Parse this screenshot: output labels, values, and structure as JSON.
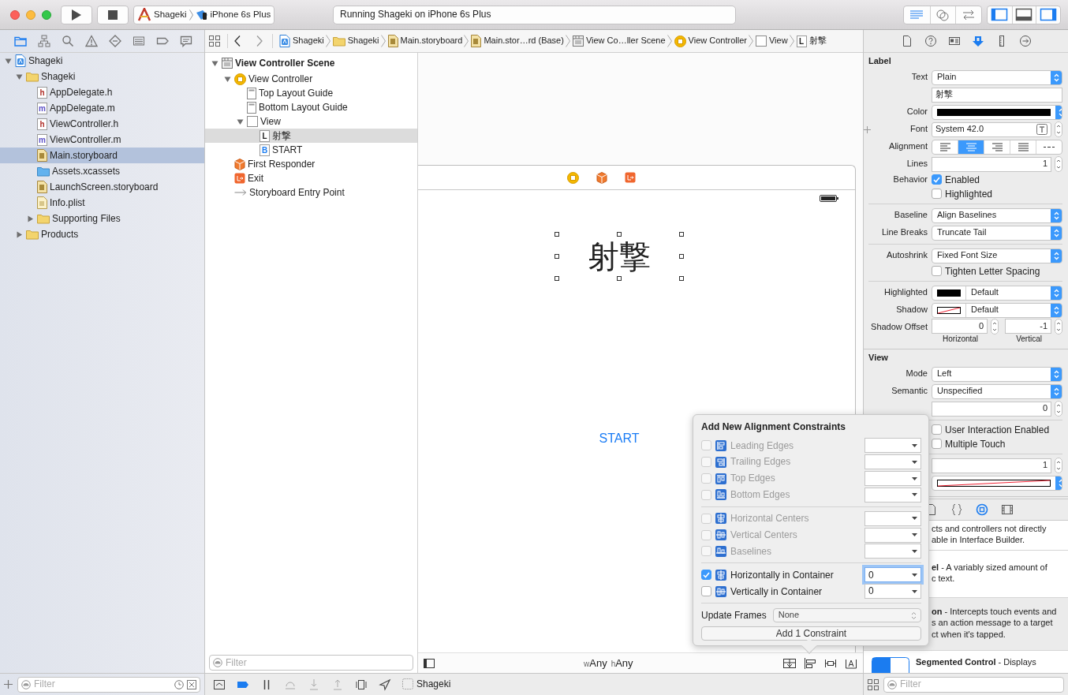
{
  "toolbar": {
    "scheme": "Shageki",
    "device": "iPhone 6s Plus",
    "status": "Running Shageki on iPhone 6s Plus",
    "editor_modes": [
      {
        "kind": "standard",
        "selected": true
      },
      {
        "kind": "assistant",
        "selected": false
      },
      {
        "kind": "version",
        "selected": false
      }
    ],
    "panels": [
      {
        "kind": "navigator",
        "on": true
      },
      {
        "kind": "debug",
        "on": false
      },
      {
        "kind": "utilities",
        "on": true
      }
    ]
  },
  "navigator": {
    "tabs": [
      {
        "kind": "project",
        "selected": true
      },
      {
        "kind": "symbol",
        "selected": false
      },
      {
        "kind": "find",
        "selected": false
      },
      {
        "kind": "issue",
        "selected": false
      },
      {
        "kind": "test",
        "selected": false
      },
      {
        "kind": "debug",
        "selected": false
      },
      {
        "kind": "breakpoint",
        "selected": false
      },
      {
        "kind": "report",
        "selected": false
      }
    ],
    "tree": [
      {
        "label": "Shageki",
        "kind": "project",
        "expanded": true,
        "selected": false,
        "children": [
          {
            "label": "Shageki",
            "kind": "folder",
            "expanded": true,
            "selected": false,
            "children": [
              {
                "label": "AppDelegate.h",
                "kind": "header",
                "glyph": "h",
                "selected": false
              },
              {
                "label": "AppDelegate.m",
                "kind": "source",
                "glyph": "m",
                "selected": false
              },
              {
                "label": "ViewController.h",
                "kind": "header",
                "glyph": "h",
                "selected": false
              },
              {
                "label": "ViewController.m",
                "kind": "source",
                "glyph": "m",
                "selected": false
              },
              {
                "label": "Main.storyboard",
                "kind": "storyboard",
                "selected": true
              },
              {
                "label": "Assets.xcassets",
                "kind": "assets",
                "selected": false
              },
              {
                "label": "LaunchScreen.storyboard",
                "kind": "storyboard",
                "selected": false
              },
              {
                "label": "Info.plist",
                "kind": "plist",
                "selected": false
              },
              {
                "label": "Supporting Files",
                "kind": "folder",
                "expanded": false,
                "selected": false
              }
            ]
          },
          {
            "label": "Products",
            "kind": "folder",
            "expanded": false,
            "selected": false
          }
        ]
      }
    ],
    "filter": {
      "placeholder": "Filter"
    }
  },
  "jump_bar": {
    "crumbs": [
      {
        "kind": "project",
        "label": "Shageki"
      },
      {
        "kind": "folder",
        "label": "Shageki"
      },
      {
        "kind": "storyboard",
        "label": "Main.storyboard"
      },
      {
        "kind": "storyboard",
        "label": "Main.stor…rd (Base)"
      },
      {
        "kind": "scene",
        "label": "View Co…ller Scene"
      },
      {
        "kind": "controller",
        "label": "View Controller"
      },
      {
        "kind": "view",
        "label": "View"
      },
      {
        "kind": "label",
        "glyph": "L",
        "label": "射撃"
      }
    ]
  },
  "outline": {
    "tree": [
      {
        "label": "View Controller Scene",
        "kind": "scene",
        "expanded": true,
        "selected": false,
        "children": [
          {
            "label": "View Controller",
            "kind": "controller",
            "expanded": true,
            "selected": false,
            "children": [
              {
                "label": "Top Layout Guide",
                "kind": "guide",
                "selected": false
              },
              {
                "label": "Bottom Layout Guide",
                "kind": "guide",
                "selected": false
              },
              {
                "label": "View",
                "kind": "view",
                "expanded": true,
                "selected": false,
                "children": [
                  {
                    "label": "射撃",
                    "kind": "label",
                    "glyph": "L",
                    "selected": true
                  },
                  {
                    "label": "START",
                    "kind": "button",
                    "glyph": "B",
                    "selected": false
                  }
                ]
              }
            ]
          },
          {
            "label": "First Responder",
            "kind": "responder",
            "selected": false
          },
          {
            "label": "Exit",
            "kind": "exit",
            "selected": false
          },
          {
            "label": "Storyboard Entry Point",
            "kind": "entry",
            "selected": false
          }
        ]
      }
    ],
    "filter": {
      "placeholder": "Filter"
    }
  },
  "canvas": {
    "dock": [
      {
        "kind": "controller"
      },
      {
        "kind": "responder"
      },
      {
        "kind": "exit"
      }
    ],
    "label": "射撃",
    "button": "START",
    "size_class": {
      "width_prefix": "w",
      "width_value": "Any",
      "height_prefix": "h",
      "height_value": "Any"
    },
    "tools": [
      {
        "kind": "embed"
      },
      {
        "kind": "align"
      },
      {
        "kind": "pin"
      },
      {
        "kind": "resolve"
      }
    ]
  },
  "popover": {
    "title": "Add New Alignment Constraints",
    "groups": [
      {
        "rows": [
          {
            "kind": "leading",
            "label": "Leading Edges",
            "checked": false,
            "disabled": true,
            "focused": false
          },
          {
            "kind": "trailing",
            "label": "Trailing Edges",
            "checked": false,
            "disabled": true,
            "focused": false
          },
          {
            "kind": "top",
            "label": "Top Edges",
            "checked": false,
            "disabled": true,
            "focused": false
          },
          {
            "kind": "bottom",
            "label": "Bottom Edges",
            "checked": false,
            "disabled": true,
            "focused": false
          }
        ]
      },
      {
        "rows": [
          {
            "kind": "hcenter",
            "label": "Horizontal Centers",
            "checked": false,
            "disabled": true,
            "focused": false
          },
          {
            "kind": "vcenter",
            "label": "Vertical Centers",
            "checked": false,
            "disabled": true,
            "focused": false
          },
          {
            "kind": "baseline",
            "label": "Baselines",
            "checked": false,
            "disabled": true,
            "focused": false
          }
        ]
      },
      {
        "rows": [
          {
            "kind": "hcenter",
            "label": "Horizontally in Container",
            "checked": true,
            "disabled": false,
            "focused": true,
            "value": "0"
          },
          {
            "kind": "vcenter",
            "label": "Vertically in Container",
            "checked": false,
            "disabled": false,
            "focused": false,
            "value": "0"
          }
        ]
      }
    ],
    "update_frames": {
      "label": "Update Frames",
      "value": "None"
    },
    "button": "Add 1 Constraint"
  },
  "inspector": {
    "tabs": [
      {
        "kind": "file",
        "selected": false
      },
      {
        "kind": "help",
        "selected": false
      },
      {
        "kind": "identity",
        "selected": false
      },
      {
        "kind": "attributes",
        "selected": true
      },
      {
        "kind": "size",
        "selected": false
      },
      {
        "kind": "connections",
        "selected": false
      }
    ],
    "sections": [
      {
        "title": "Label",
        "rows": [
          {
            "kind": "popup",
            "label": "Text",
            "value": "Plain"
          },
          {
            "kind": "text",
            "value": "射撃"
          },
          {
            "kind": "color",
            "label": "Color",
            "clear": false
          },
          {
            "kind": "font",
            "label": "Font",
            "value": "System 42.0"
          },
          {
            "kind": "segmented",
            "label": "Alignment",
            "segments": [
              {
                "kind": "left",
                "selected": false
              },
              {
                "kind": "center",
                "selected": true
              },
              {
                "kind": "right",
                "selected": false
              },
              {
                "kind": "justified",
                "selected": false
              },
              {
                "kind": "natural",
                "selected": false
              }
            ]
          },
          {
            "kind": "stepper",
            "label": "Lines",
            "value": "1"
          },
          {
            "kind": "checkbox",
            "label": "Behavior",
            "text": "Enabled",
            "checked": true
          },
          {
            "kind": "checkbox",
            "text": "Highlighted",
            "checked": false
          },
          {
            "kind": "divider"
          },
          {
            "kind": "popup",
            "label": "Baseline",
            "value": "Align Baselines"
          },
          {
            "kind": "popup",
            "label": "Line Breaks",
            "value": "Truncate Tail"
          },
          {
            "kind": "divider"
          },
          {
            "kind": "popup",
            "label": "Autoshrink",
            "value": "Fixed Font Size"
          },
          {
            "kind": "checkbox",
            "text": "Tighten Letter Spacing",
            "checked": false
          },
          {
            "kind": "divider"
          },
          {
            "kind": "color-popup",
            "label": "Highlighted",
            "clear": false,
            "value": "Default"
          },
          {
            "kind": "color-popup",
            "label": "Shadow",
            "clear": true,
            "value": "Default"
          },
          {
            "kind": "offset",
            "label": "Shadow Offset",
            "fields": [
              {
                "value": "0",
                "caption": "Horizontal"
              },
              {
                "value": "-1",
                "caption": "Vertical"
              }
            ]
          }
        ]
      },
      {
        "title": "View",
        "rows": [
          {
            "kind": "popup",
            "label": "Mode",
            "value": "Left"
          },
          {
            "kind": "popup",
            "label": "Semantic",
            "value": "Unspecified"
          },
          {
            "kind": "stepper",
            "value": "0"
          },
          {
            "kind": "divider"
          },
          {
            "kind": "checkbox",
            "text": "User Interaction Enabled",
            "checked": false
          },
          {
            "kind": "checkbox",
            "text": "Multiple Touch",
            "checked": false
          },
          {
            "kind": "divider"
          },
          {
            "kind": "stepper",
            "value": "1"
          },
          {
            "kind": "color",
            "clear": true
          }
        ]
      }
    ]
  },
  "library": {
    "tabs": [
      {
        "kind": "file",
        "selected": false
      },
      {
        "kind": "code",
        "selected": false
      },
      {
        "kind": "object",
        "selected": true
      },
      {
        "kind": "media",
        "selected": false
      }
    ],
    "items": [
      {
        "kind": "text",
        "selected": false,
        "lines": [
          "cts and controllers not directly",
          "able in Interface Builder."
        ]
      },
      {
        "kind": "text",
        "selected": false,
        "lines": [
          "**el** - A variably sized amount of",
          "c text."
        ]
      },
      {
        "kind": "text",
        "selected": true,
        "lines": [
          "**on** - Intercepts touch events and",
          "s an action message to a target",
          "ct when it's tapped."
        ]
      },
      {
        "kind": "segmented-control",
        "selected": false,
        "lines": [
          "**Segmented Control** - Displays"
        ]
      }
    ],
    "filter": {
      "placeholder": "Filter"
    }
  },
  "debug_bar": {
    "buttons": [
      {
        "kind": "console",
        "on": false
      },
      {
        "kind": "breakpoints",
        "on": true
      },
      {
        "kind": "pause",
        "on": false
      },
      {
        "kind": "step-over",
        "on": false
      },
      {
        "kind": "step-in",
        "on": false
      },
      {
        "kind": "step-out",
        "on": false
      },
      {
        "kind": "view-debug",
        "on": false
      },
      {
        "kind": "location",
        "on": false
      }
    ],
    "target": "Shageki"
  }
}
